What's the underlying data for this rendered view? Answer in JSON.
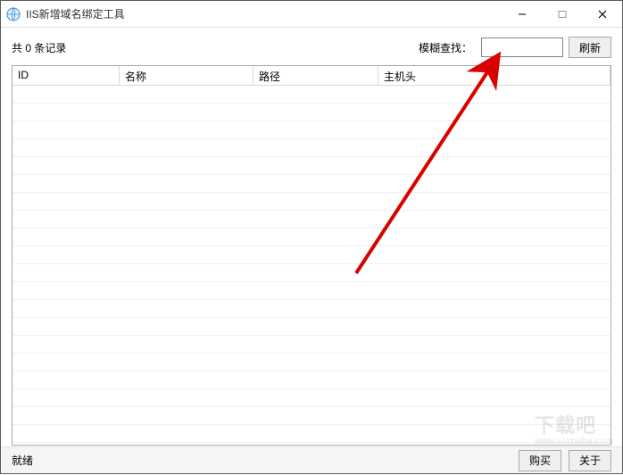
{
  "window": {
    "title": "IIS新增域名绑定工具"
  },
  "toolbar": {
    "record_count_text": "共 0 条记录",
    "search_label": "模糊查找：",
    "search_value": "",
    "refresh_label": "刷新"
  },
  "table": {
    "columns": {
      "id": "ID",
      "name": "名称",
      "path": "路径",
      "host": "主机头"
    },
    "rows": []
  },
  "statusbar": {
    "status_text": "就绪",
    "buy_label": "购买",
    "about_label": "关于"
  },
  "watermark": {
    "main": "下载吧",
    "sub": "www.xiazaiba.com"
  }
}
